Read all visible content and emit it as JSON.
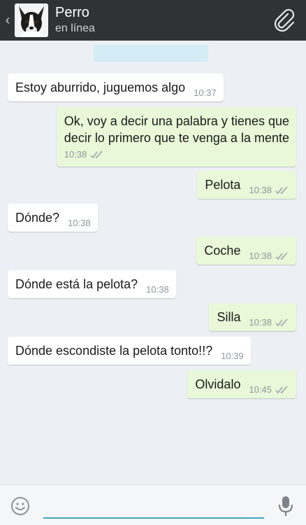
{
  "header": {
    "contact_name": "Perro",
    "status": "en línea",
    "back_icon": "chevron-left-icon",
    "attach_icon": "paperclip-icon"
  },
  "colors": {
    "header_bg": "#303335",
    "chat_bg": "#eceff3",
    "incoming_bubble": "#ffffff",
    "outgoing_bubble": "#e8f8d8",
    "input_accent": "#3aa5c4"
  },
  "messages": [
    {
      "direction": "in",
      "text": "Estoy aburrido, juguemos algo",
      "time": "10:37"
    },
    {
      "direction": "out",
      "text": "Ok,  voy a decir una palabra y tienes que\ndecir lo primero que te venga a la mente",
      "time": "10:38",
      "status": "read"
    },
    {
      "direction": "out",
      "text": "Pelota",
      "time": "10:38",
      "status": "read"
    },
    {
      "direction": "in",
      "text": "Dónde?",
      "time": "10:38"
    },
    {
      "direction": "out",
      "text": "Coche",
      "time": "10:38",
      "status": "read"
    },
    {
      "direction": "in",
      "text": "Dónde está la pelota?",
      "time": "10:38"
    },
    {
      "direction": "out",
      "text": "Silla",
      "time": "10:38",
      "status": "read"
    },
    {
      "direction": "in",
      "text": "Dónde escondiste la pelota tonto!!?",
      "time": "10:39"
    },
    {
      "direction": "out",
      "text": "Olvidalo",
      "time": "10:45",
      "status": "read"
    }
  ],
  "composer": {
    "placeholder": "",
    "emoji_icon": "smiley-icon",
    "mic_icon": "microphone-icon"
  }
}
